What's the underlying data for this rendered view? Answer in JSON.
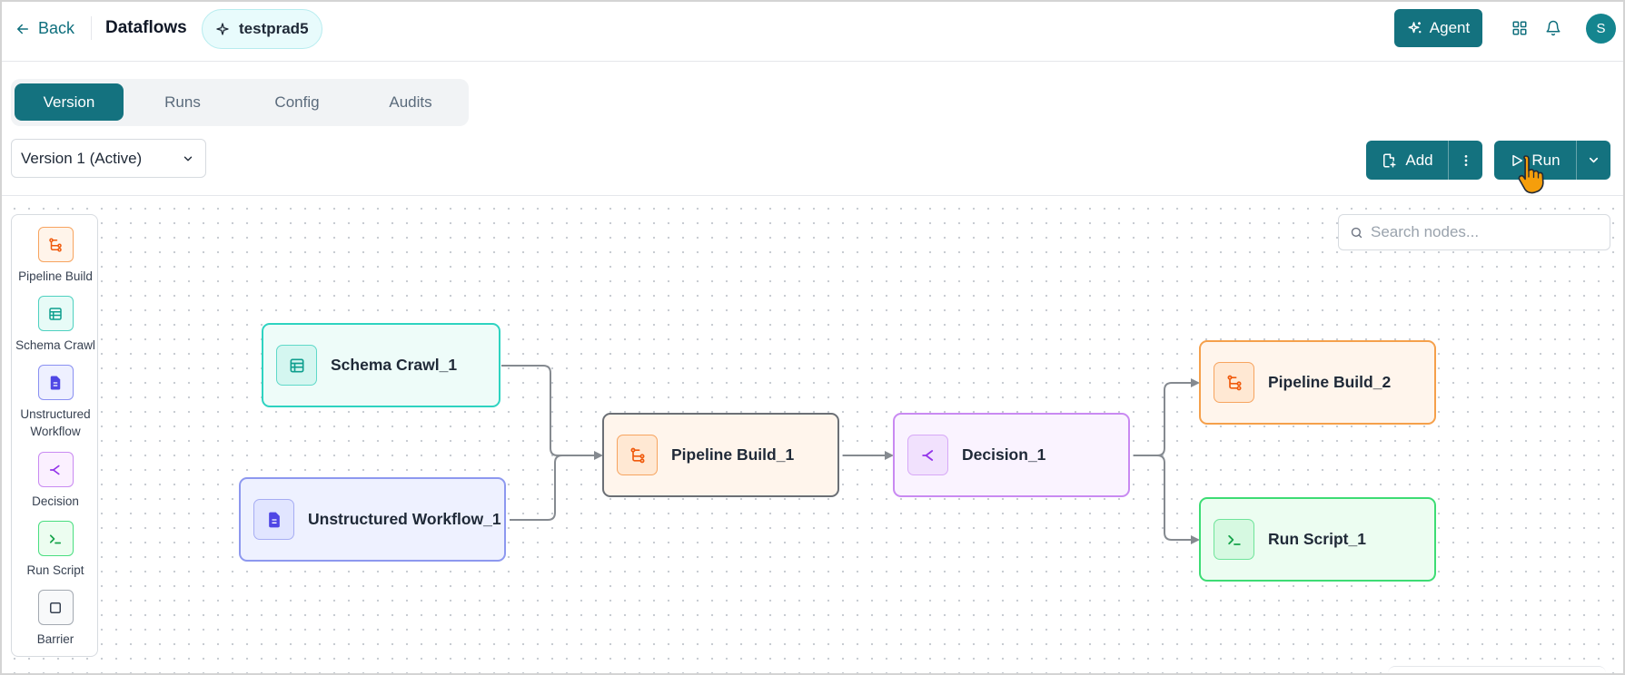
{
  "header": {
    "back_label": "Back",
    "title": "Dataflows",
    "project_name": "testprad5",
    "agent_label": "Agent",
    "avatar_initial": "S"
  },
  "tabs": [
    {
      "label": "Version",
      "active": true
    },
    {
      "label": "Runs",
      "active": false
    },
    {
      "label": "Config",
      "active": false
    },
    {
      "label": "Audits",
      "active": false
    }
  ],
  "version_select": {
    "value": "Version 1 (Active)"
  },
  "toolbar": {
    "add_label": "Add",
    "run_label": "Run"
  },
  "search": {
    "placeholder": "Search nodes..."
  },
  "palette": [
    {
      "label": "Pipeline Build",
      "icon": "pipeline-icon"
    },
    {
      "label": "Schema Crawl",
      "icon": "table-icon"
    },
    {
      "label": "Unstructured Workflow",
      "icon": "document-icon"
    },
    {
      "label": "Decision",
      "icon": "decision-icon"
    },
    {
      "label": "Run Script",
      "icon": "terminal-icon"
    },
    {
      "label": "Barrier",
      "icon": "square-icon"
    }
  ],
  "nodes": [
    {
      "label": "Schema Crawl_1",
      "type": "schema-crawl"
    },
    {
      "label": "Unstructured Workflow_1",
      "type": "unstructured-workflow"
    },
    {
      "label": "Pipeline Build_1",
      "type": "pipeline-build"
    },
    {
      "label": "Decision_1",
      "type": "decision"
    },
    {
      "label": "Pipeline Build_2",
      "type": "pipeline-build"
    },
    {
      "label": "Run Script_1",
      "type": "run-script"
    }
  ],
  "edges": [
    {
      "from": "Schema Crawl_1",
      "to": "Pipeline Build_1"
    },
    {
      "from": "Unstructured Workflow_1",
      "to": "Pipeline Build_1"
    },
    {
      "from": "Pipeline Build_1",
      "to": "Decision_1"
    },
    {
      "from": "Decision_1",
      "to": "Pipeline Build_2"
    },
    {
      "from": "Decision_1",
      "to": "Run Script_1"
    }
  ],
  "colors": {
    "primary": "#14727f",
    "pipeline": "#f97316",
    "schema": "#14b8a6",
    "unstructured": "#6366f1",
    "decision": "#a855f7",
    "runscript": "#22c55e",
    "barrier": "#6b7280"
  }
}
